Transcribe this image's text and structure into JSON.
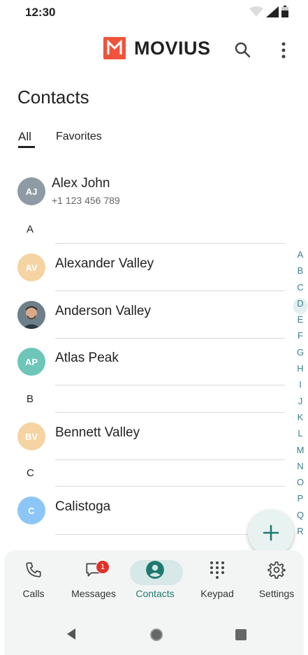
{
  "status": {
    "time": "12:30"
  },
  "header": {
    "brand": "MOVIUS",
    "title": "Contacts"
  },
  "tabs": [
    {
      "label": "All",
      "active": true
    },
    {
      "label": "Favorites",
      "active": false
    }
  ],
  "contacts": [
    {
      "initials": "AJ",
      "name": "Alex John",
      "phone": "+1 123 456 789",
      "color": "#8e9ba4"
    },
    {
      "initials": "AV",
      "name": "Alexander Valley",
      "color": "#f5d3a2"
    },
    {
      "initials": "",
      "name": "Anderson Valley",
      "color": "#7a6a5a"
    },
    {
      "initials": "AP",
      "name": "Atlas Peak",
      "color": "#6dc6b8"
    },
    {
      "initials": "BV",
      "name": "Bennett Valley",
      "color": "#f5d3a2"
    },
    {
      "initials": "C",
      "name": "Calistoga",
      "color": "#8cc6f6"
    }
  ],
  "sections": [
    "A",
    "B",
    "C"
  ],
  "index_letters": [
    "A",
    "B",
    "C",
    "D",
    "E",
    "F",
    "G",
    "H",
    "I",
    "J",
    "K",
    "L",
    "M",
    "N",
    "O",
    "P",
    "Q",
    "R"
  ],
  "index_active": "D",
  "nav": [
    {
      "label": "Calls"
    },
    {
      "label": "Messages",
      "badge": "1"
    },
    {
      "label": "Contacts",
      "active": true
    },
    {
      "label": "Keypad"
    },
    {
      "label": "Settings"
    }
  ],
  "colors": {
    "brand": "#f0533b",
    "accent": "#1e7a6e",
    "index": "#3b7f8c"
  }
}
